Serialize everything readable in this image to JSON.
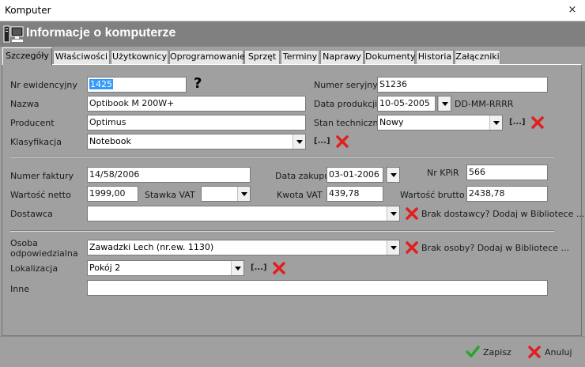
{
  "window": {
    "title": "Komputer",
    "close_glyph": "×"
  },
  "header": {
    "title": "Informacje o komputerze",
    "icon": "computer-icon"
  },
  "tabs": [
    {
      "label": "Szczegóły",
      "active": true
    },
    {
      "label": "Właściwości"
    },
    {
      "label": "Użytkownicy"
    },
    {
      "label": "Oprogramowanie"
    },
    {
      "label": "Sprzęt"
    },
    {
      "label": "Terminy"
    },
    {
      "label": "Naprawy"
    },
    {
      "label": "Dokumenty"
    },
    {
      "label": "Historia"
    },
    {
      "label": "Załączniki"
    }
  ],
  "general": {
    "nr_ewid_label": "Nr ewidencyjny",
    "nr_ewid_value": "1425",
    "question": "?",
    "nazwa_label": "Nazwa",
    "nazwa_value": "Optibook M 200W+",
    "producent_label": "Producent",
    "producent_value": "Optimus",
    "klasyfikacja_label": "Klasyfikacja",
    "klasyfikacja_value": "Notebook",
    "numer_seryjny_label": "Numer seryjny",
    "numer_seryjny_value": "S1236",
    "data_produkcji_label": "Data produkcji",
    "data_produkcji_value": "10-05-2005",
    "date_format": "DD-MM-RRRR",
    "stan_label": "Stan techniczny",
    "stan_value": "Nowy",
    "dots": "[...]"
  },
  "purchase": {
    "faktura_label": "Numer faktury",
    "faktura_value": "14/58/2006",
    "data_zakupu_label": "Data zakupu",
    "data_zakupu_value": "03-01-2006",
    "kpir_label": "Nr KPiR",
    "kpir_value": "566",
    "netto_label": "Wartość netto",
    "netto_value": "1999,00",
    "stawka_label": "Stawka VAT",
    "stawka_value": "",
    "kwota_vat_label": "Kwota VAT",
    "kwota_vat_value": "439,78",
    "brutto_label": "Wartość brutto",
    "brutto_value": "2438,78",
    "dostawca_label": "Dostawca",
    "dostawca_value": "",
    "dostawca_link": "Brak dostawcy? Dodaj w Bibliotece ..."
  },
  "assignment": {
    "osoba_label_1": "Osoba",
    "osoba_label_2": "odpowiedzialna",
    "osoba_value": "Zawadzki Lech (nr.ew. 1130)",
    "osoba_link": "Brak osoby? Dodaj w Bibliotece ...",
    "lokalizacja_label": "Lokalizacja",
    "lokalizacja_value": "Pokój 2",
    "inne_label": "Inne",
    "inne_value": ""
  },
  "footer": {
    "save_label": "Zapisz",
    "cancel_label": "Anuluj"
  },
  "colors": {
    "delete_red": "#e02020",
    "save_green": "#2aa52a",
    "header_bg": "#808080",
    "panel_bg": "#a0a0a0",
    "selection": "#3399ff"
  }
}
